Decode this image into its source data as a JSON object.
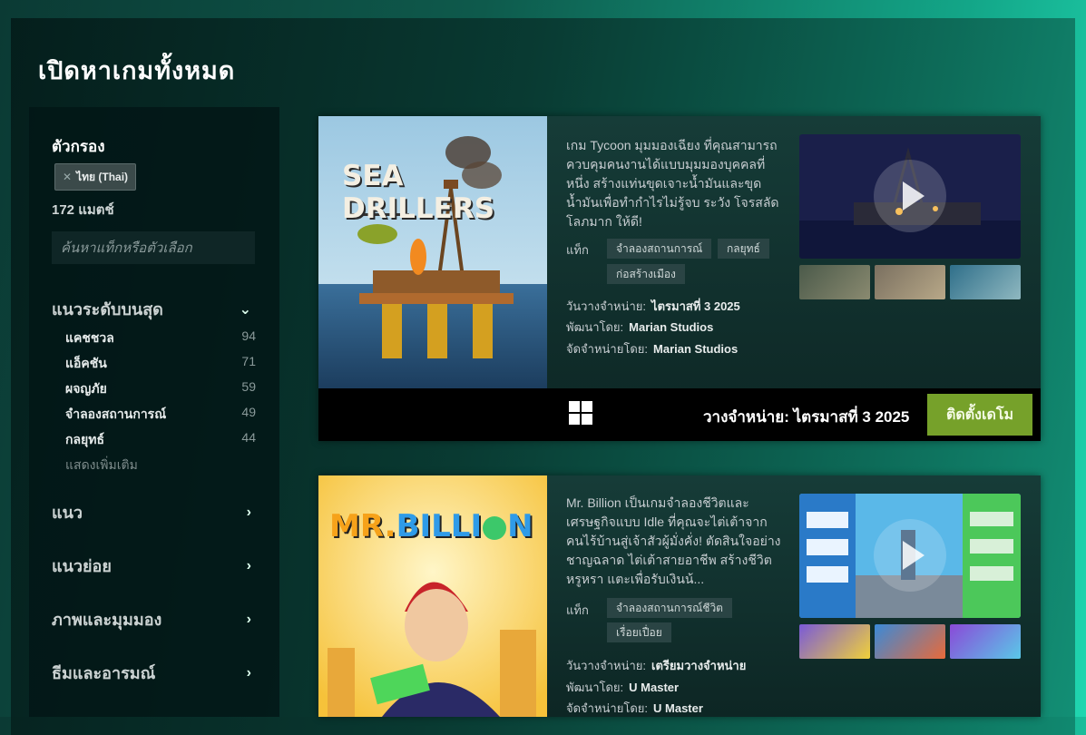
{
  "page": {
    "title": "เปิดหาเกมทั้งหมด"
  },
  "sidebar": {
    "filter_title": "ตัวกรอง",
    "active_filter": "ไทย (Thai)",
    "match_count": "172 แมตช์",
    "search_placeholder": "ค้นหาแท็กหรือตัวเลือก",
    "top_level": {
      "label": "แนวระดับบนสุด",
      "expanded": true
    },
    "categories": [
      {
        "label": "แคชชวล",
        "count": "94"
      },
      {
        "label": "แอ็คชัน",
        "count": "71"
      },
      {
        "label": "ผจญภัย",
        "count": "59"
      },
      {
        "label": "จำลองสถานการณ์",
        "count": "49"
      },
      {
        "label": "กลยุทธ์",
        "count": "44"
      }
    ],
    "show_more": "แสดงเพิ่มเติม",
    "sections": [
      "แนว",
      "แนวย่อย",
      "ภาพและมุมมอง",
      "ธีมและอารมณ์"
    ]
  },
  "games": [
    {
      "cover_title": "SEA DRILLERS",
      "description": "เกม Tycoon มุมมองเฉียง ที่คุณสามารถ ควบคุมคนงานได้แบบมุมมองบุคคลที่หนึ่ง สร้างแท่นขุดเจาะน้ำมันและขุดน้ำมันเพื่อทำกำไรไม่รู้จบ ระวัง โจรสลัดโลภมาก ให้ดี!",
      "tags_label": "แท็ก",
      "tags": [
        "จำลองสถานการณ์",
        "กลยุทธ์",
        "ก่อสร้างเมือง"
      ],
      "release_label": "วันวางจำหน่าย:",
      "release_value": "ไตรมาสที่ 3 2025",
      "developer_label": "พัฒนาโดย:",
      "developer": "Marian Studios",
      "publisher_label": "จัดจำหน่ายโดย:",
      "publisher": "Marian Studios",
      "bar_release": "วางจำหน่าย: ไตรมาสที่ 3 2025",
      "install_label": "ติดตั้งเดโม"
    },
    {
      "cover_title_a": "MR.",
      "cover_title_b": "BILLI",
      "cover_title_c": "N",
      "description": "Mr. Billion เป็นเกมจำลองชีวิตและเศรษฐกิจแบบ Idle ที่คุณจะไต่เต้าจากคนไร้บ้านสู่เจ้าสัวผู้มั่งคั่ง! ตัดสินใจอย่างชาญฉลาด ไต่เต้าสายอาชีพ สร้างชีวิตหรูหรา แตะเพื่อรับเงินน้...",
      "tags_label": "แท็ก",
      "tags": [
        "จำลองสถานการณ์ชีวิต",
        "เรื่อยเปื่อย"
      ],
      "release_label": "วันวางจำหน่าย:",
      "release_value": "เตรียมวางจำหน่าย",
      "developer_label": "พัฒนาโดย:",
      "developer": "U Master",
      "publisher_label": "จัดจำหน่ายโดย:",
      "publisher": "U Master"
    }
  ]
}
